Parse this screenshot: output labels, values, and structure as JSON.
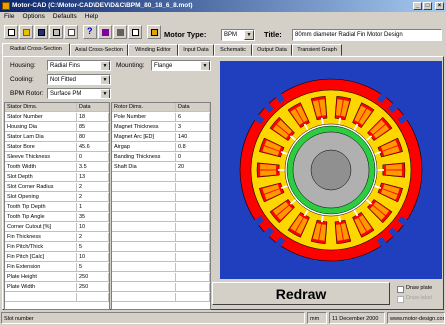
{
  "window": {
    "title": "Motor-CAD (C:\\Motor-CAD\\DEV\\D&C\\BPM_80_18_6_8.mot)"
  },
  "menu": [
    "File",
    "Options",
    "Defaults",
    "Help"
  ],
  "toolbar": {
    "motor_type_label": "Motor Type:",
    "motor_type_value": "BPM",
    "title_label": "Title:",
    "title_value": "80mm diameter Radial Fin Motor Design"
  },
  "tabs": [
    "Radial Cross-Section",
    "Axial Cross-Section",
    "Winding Editor",
    "Input Data",
    "Schematic",
    "Output Data",
    "Transient Graph"
  ],
  "form": {
    "housing_label": "Housing:",
    "housing_value": "Radial Fins",
    "mounting_label": "Mounting:",
    "mounting_value": "Flange",
    "cooling_label": "Cooling:",
    "cooling_value": "Not Fitted",
    "rotor_label": "BPM Rotor:",
    "rotor_value": "Surface PM"
  },
  "stator_table": {
    "headers": [
      "Stator Dims.",
      "Data"
    ],
    "rows": [
      [
        "Stator Number",
        "18"
      ],
      [
        "Housing Dia",
        "85"
      ],
      [
        "Stator Lam Dia",
        "80"
      ],
      [
        "Stator Bore",
        "45.6"
      ],
      [
        "Sleeve Thickness",
        "0"
      ],
      [
        "Tooth Width",
        "3.5"
      ],
      [
        "Slot Depth",
        "13"
      ],
      [
        "Slot Corner Radius",
        "2"
      ],
      [
        "Slot Opening",
        "2"
      ],
      [
        "Tooth Tip Depth",
        "1"
      ],
      [
        "Tooth Tip Angle",
        "35"
      ],
      [
        "Corner Cutout [%]",
        "10"
      ],
      [
        "Fin Thickness",
        "2"
      ],
      [
        "Fin Pitch/Thick",
        "5"
      ],
      [
        "Fin Pitch [Calc]",
        "10"
      ],
      [
        "Fin Extension",
        "5"
      ],
      [
        "Plate Height",
        "250"
      ],
      [
        "Plate Width",
        "250"
      ]
    ]
  },
  "rotor_table": {
    "headers": [
      "Rotor Dims.",
      "Data"
    ],
    "rows": [
      [
        "Pole Number",
        "6"
      ],
      [
        "Magnet Thickness",
        "3"
      ],
      [
        "Magnet Arc [ED]",
        "140"
      ],
      [
        "Airgap",
        "0.8"
      ],
      [
        "Banding Thickness",
        "0"
      ],
      [
        "Shaft Dia",
        "20"
      ]
    ]
  },
  "redraw_label": "Redraw",
  "draw_plate_label": "Draw plate",
  "draw_label_2": "Draw label",
  "status": {
    "text": "Slot number",
    "units": "mm",
    "date": "11 December 2000",
    "website": "www.motor-design.com"
  },
  "colors": {
    "drawing_bg": "#1f3fbf",
    "housing": "#ff0000",
    "stator": "#ffd700",
    "winding": "#ff9900",
    "magnet_ring": "#2ecc40",
    "rotor": "#b0b0b0",
    "shaft": "#909090"
  }
}
